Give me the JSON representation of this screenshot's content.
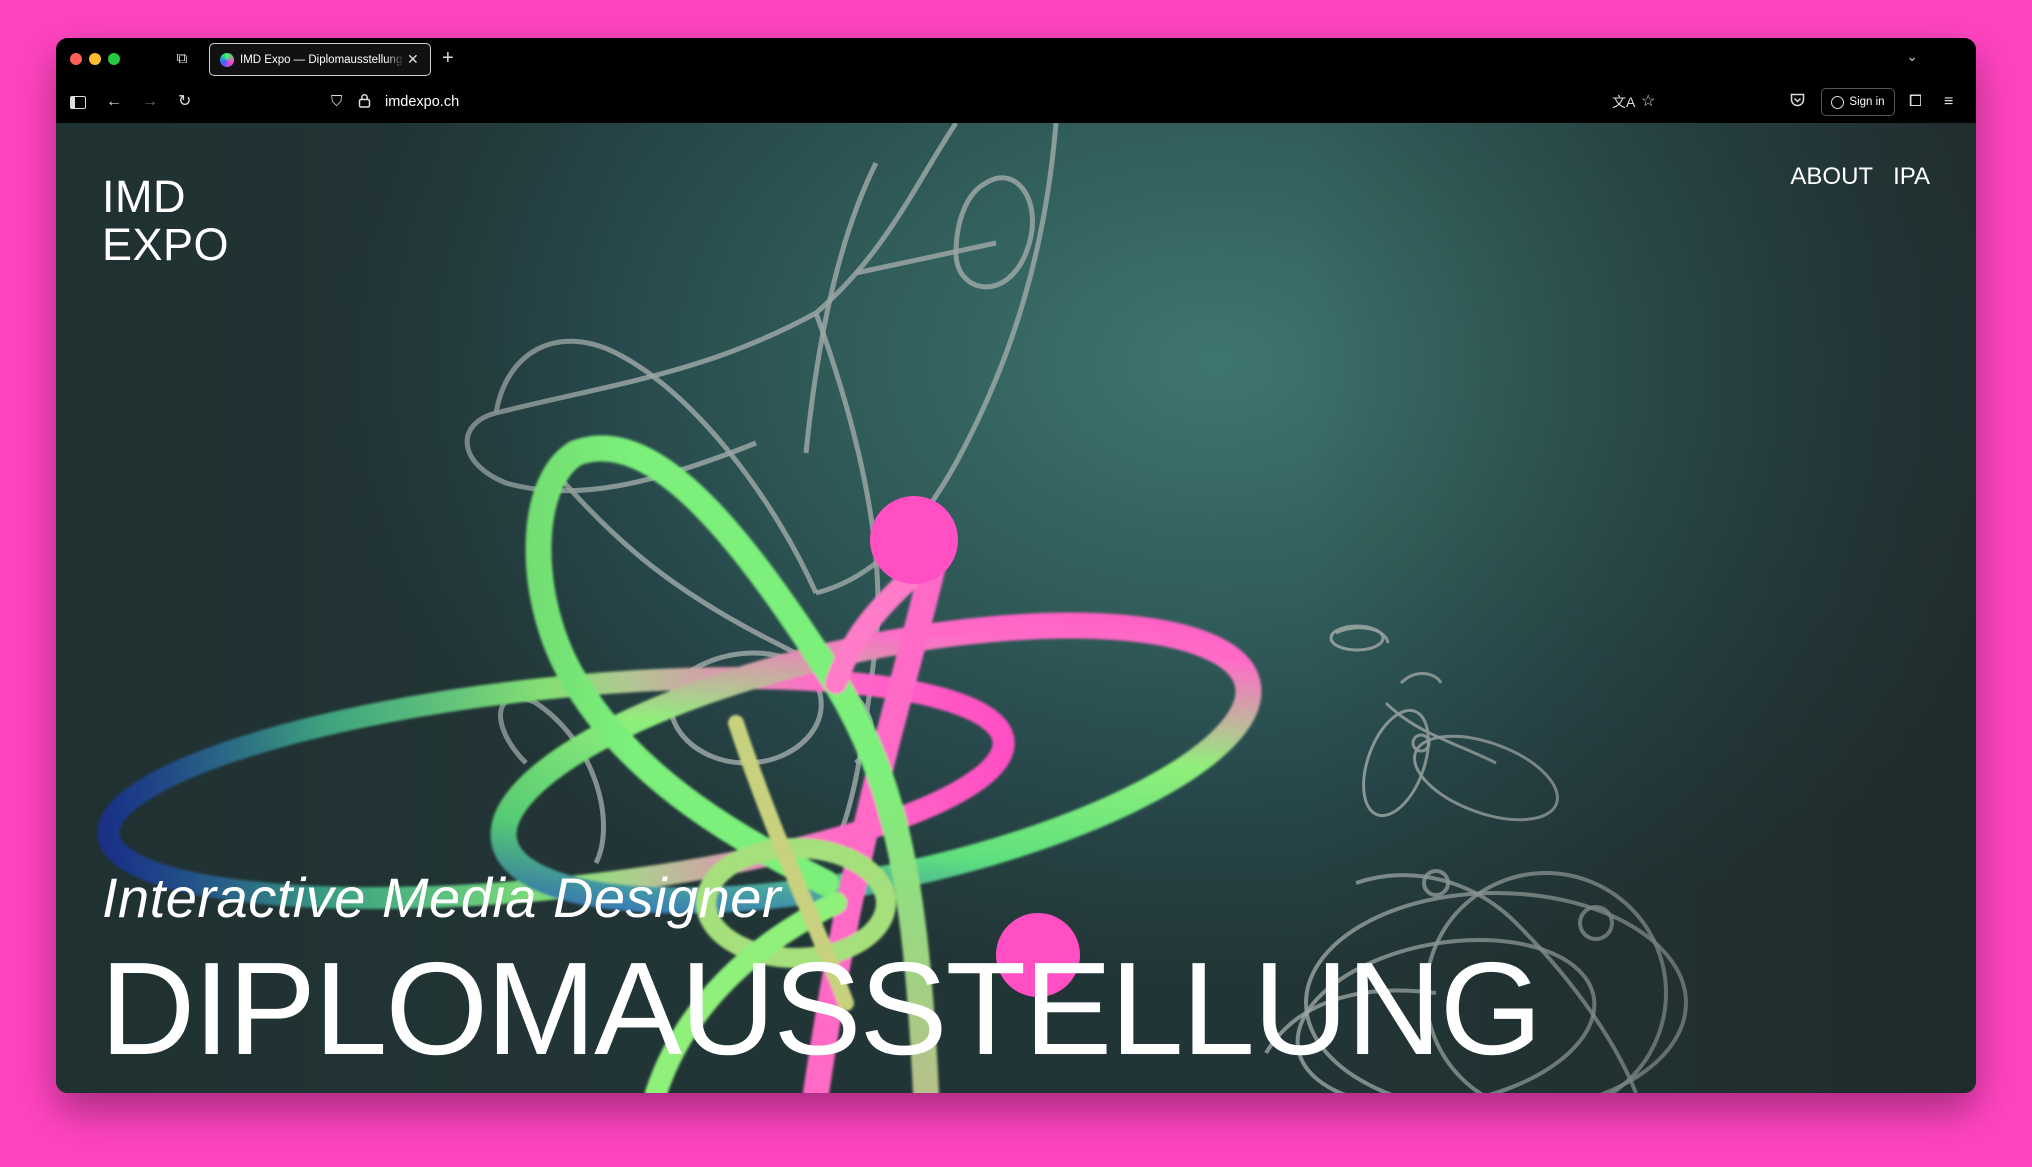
{
  "browser": {
    "tab": {
      "title": "IMD Expo — Diplomausstellung",
      "close_icon": "close-icon",
      "favicon": "imd-expo-favicon"
    },
    "new_tab_icon": "plus-icon",
    "tab_list_icon": "chevron-down-icon",
    "url": "imdexpo.ch",
    "sign_in_label": "Sign in",
    "glyphs": {
      "tab_overview": "⧉",
      "close": "✕",
      "new_tab": "+",
      "tab_list": "⌄",
      "back": "←",
      "forward": "→",
      "reload": "↻",
      "shield": "⛉",
      "lock": "🔒",
      "translate": "文A",
      "star": "☆",
      "pocket": "◡",
      "extensions": "⧠",
      "menu": "≡"
    }
  },
  "site": {
    "logo_line1": "IMD",
    "logo_line2": "EXPO",
    "nav": [
      "ABOUT",
      "IPA"
    ],
    "subtitle": "Interactive Media Designer",
    "headline": "DIPLOMAUSSTELLUNG"
  },
  "colors": {
    "backdrop": "#ff44c0",
    "background_teal": "#3f7571",
    "art_green": "#7cf07a",
    "art_pink": "#ff4fc3",
    "art_blue": "#1f3bd9",
    "outline_gray": "#9aa6a4"
  }
}
